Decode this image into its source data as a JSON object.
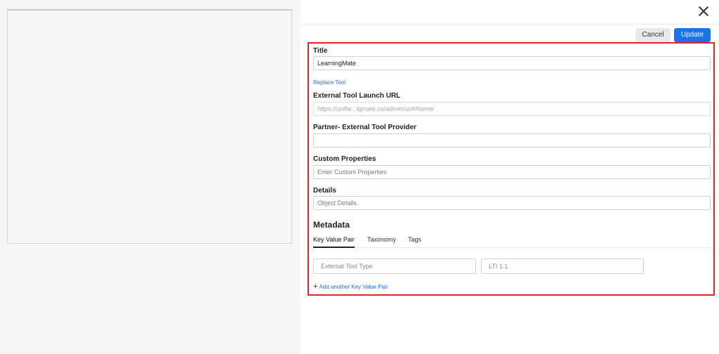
{
  "header": {
    "cancel_label": "Cancel",
    "update_label": "Update"
  },
  "form": {
    "title_label": "Title",
    "title_value": "LearningMate",
    "replace_tool_link": "Replace Tool",
    "launch_url_label": "External Tool Launch URL",
    "launch_url_value": "https://unifie...lgmate.co/admin/ui/#/home/",
    "provider_label": "Partner- External Tool Provider",
    "provider_value": "",
    "custom_props_label": "Custom Properties",
    "custom_props_placeholder": "Enter Custom Properties",
    "details_label": "Details",
    "details_placeholder": "Object Details"
  },
  "metadata": {
    "title": "Metadata",
    "tabs": [
      "Key Value Pair",
      "Taxonomy",
      "Tags"
    ],
    "active_tab": "Key Value Pair",
    "key_placeholder": "External Tool Type",
    "value_placeholder": "LTI 1.1",
    "add_link": "Add another Key Value Pair"
  },
  "colors": {
    "accent": "#1a73e8",
    "highlight_border": "#e0242a"
  }
}
